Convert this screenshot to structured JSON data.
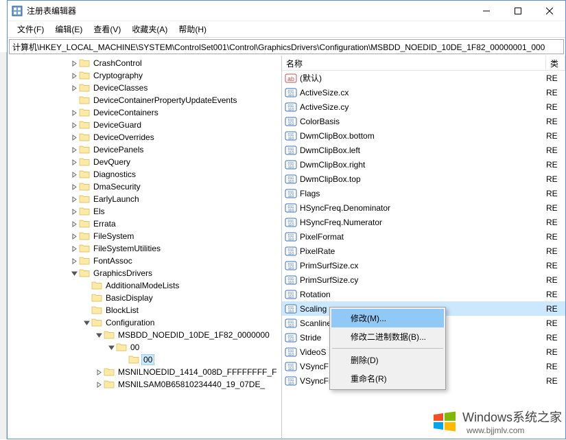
{
  "window": {
    "title": "注册表编辑器"
  },
  "menubar": {
    "items": [
      {
        "label": "文件(F)"
      },
      {
        "label": "编辑(E)"
      },
      {
        "label": "查看(V)"
      },
      {
        "label": "收藏夹(A)"
      },
      {
        "label": "帮助(H)"
      }
    ]
  },
  "addressbar": {
    "path": "计算机\\HKEY_LOCAL_MACHINE\\SYSTEM\\ControlSet001\\Control\\GraphicsDrivers\\Configuration\\MSBDD_NOEDID_10DE_1F82_00000001_000"
  },
  "tree": {
    "items": [
      {
        "depth": 5,
        "expander": ">",
        "label": "CrashControl"
      },
      {
        "depth": 5,
        "expander": ">",
        "label": "Cryptography"
      },
      {
        "depth": 5,
        "expander": ">",
        "label": "DeviceClasses"
      },
      {
        "depth": 5,
        "expander": "",
        "label": "DeviceContainerPropertyUpdateEvents"
      },
      {
        "depth": 5,
        "expander": ">",
        "label": "DeviceContainers"
      },
      {
        "depth": 5,
        "expander": ">",
        "label": "DeviceGuard"
      },
      {
        "depth": 5,
        "expander": ">",
        "label": "DeviceOverrides"
      },
      {
        "depth": 5,
        "expander": ">",
        "label": "DevicePanels"
      },
      {
        "depth": 5,
        "expander": ">",
        "label": "DevQuery"
      },
      {
        "depth": 5,
        "expander": ">",
        "label": "Diagnostics"
      },
      {
        "depth": 5,
        "expander": ">",
        "label": "DmaSecurity"
      },
      {
        "depth": 5,
        "expander": ">",
        "label": "EarlyLaunch"
      },
      {
        "depth": 5,
        "expander": ">",
        "label": "Els"
      },
      {
        "depth": 5,
        "expander": ">",
        "label": "Errata"
      },
      {
        "depth": 5,
        "expander": ">",
        "label": "FileSystem"
      },
      {
        "depth": 5,
        "expander": ">",
        "label": "FileSystemUtilities"
      },
      {
        "depth": 5,
        "expander": ">",
        "label": "FontAssoc"
      },
      {
        "depth": 5,
        "expander": "v",
        "label": "GraphicsDrivers"
      },
      {
        "depth": 6,
        "expander": "",
        "label": "AdditionalModeLists"
      },
      {
        "depth": 6,
        "expander": "",
        "label": "BasicDisplay"
      },
      {
        "depth": 6,
        "expander": "",
        "label": "BlockList"
      },
      {
        "depth": 6,
        "expander": "v",
        "label": "Configuration"
      },
      {
        "depth": 7,
        "expander": "v",
        "label": "MSBDD_NOEDID_10DE_1F82_0000000"
      },
      {
        "depth": 8,
        "expander": "v",
        "label": "00"
      },
      {
        "depth": 9,
        "expander": "",
        "label": "00",
        "selected": true
      },
      {
        "depth": 7,
        "expander": ">",
        "label": "MSNILNOEDID_1414_008D_FFFFFFFF_F"
      },
      {
        "depth": 7,
        "expander": ">",
        "label": "MSNILSAM0B65810234440_19_07DE_"
      }
    ]
  },
  "list": {
    "header_name": "名称",
    "header_type": "类",
    "items": [
      {
        "icon": "string",
        "name": "(默认)",
        "type": "RE"
      },
      {
        "icon": "binary",
        "name": "ActiveSize.cx",
        "type": "RE"
      },
      {
        "icon": "binary",
        "name": "ActiveSize.cy",
        "type": "RE"
      },
      {
        "icon": "binary",
        "name": "ColorBasis",
        "type": "RE"
      },
      {
        "icon": "binary",
        "name": "DwmClipBox.bottom",
        "type": "RE"
      },
      {
        "icon": "binary",
        "name": "DwmClipBox.left",
        "type": "RE"
      },
      {
        "icon": "binary",
        "name": "DwmClipBox.right",
        "type": "RE"
      },
      {
        "icon": "binary",
        "name": "DwmClipBox.top",
        "type": "RE"
      },
      {
        "icon": "binary",
        "name": "Flags",
        "type": "RE"
      },
      {
        "icon": "binary",
        "name": "HSyncFreq.Denominator",
        "type": "RE"
      },
      {
        "icon": "binary",
        "name": "HSyncFreq.Numerator",
        "type": "RE"
      },
      {
        "icon": "binary",
        "name": "PixelFormat",
        "type": "RE"
      },
      {
        "icon": "binary",
        "name": "PixelRate",
        "type": "RE"
      },
      {
        "icon": "binary",
        "name": "PrimSurfSize.cx",
        "type": "RE"
      },
      {
        "icon": "binary",
        "name": "PrimSurfSize.cy",
        "type": "RE"
      },
      {
        "icon": "binary",
        "name": "Rotation",
        "type": "RE"
      },
      {
        "icon": "binary",
        "name": "Scaling",
        "type": "RE",
        "selected": true
      },
      {
        "icon": "binary",
        "name": "Scanline",
        "type": "RE"
      },
      {
        "icon": "binary",
        "name": "Stride",
        "type": "RE"
      },
      {
        "icon": "binary",
        "name": "VideoS",
        "type": "RE"
      },
      {
        "icon": "binary",
        "name": "VSyncF",
        "type": "RE"
      },
      {
        "icon": "binary",
        "name": "VSyncFreq.Numerator",
        "type": "RE"
      }
    ]
  },
  "context_menu": {
    "items": [
      {
        "label": "修改(M)...",
        "highlighted": true
      },
      {
        "label": "修改二进制数据(B)..."
      },
      {
        "sep": true
      },
      {
        "label": "删除(D)"
      },
      {
        "label": "重命名(R)"
      }
    ]
  },
  "watermark": {
    "text": "Windows系统之家",
    "url": "www.bjjmlv.com"
  }
}
